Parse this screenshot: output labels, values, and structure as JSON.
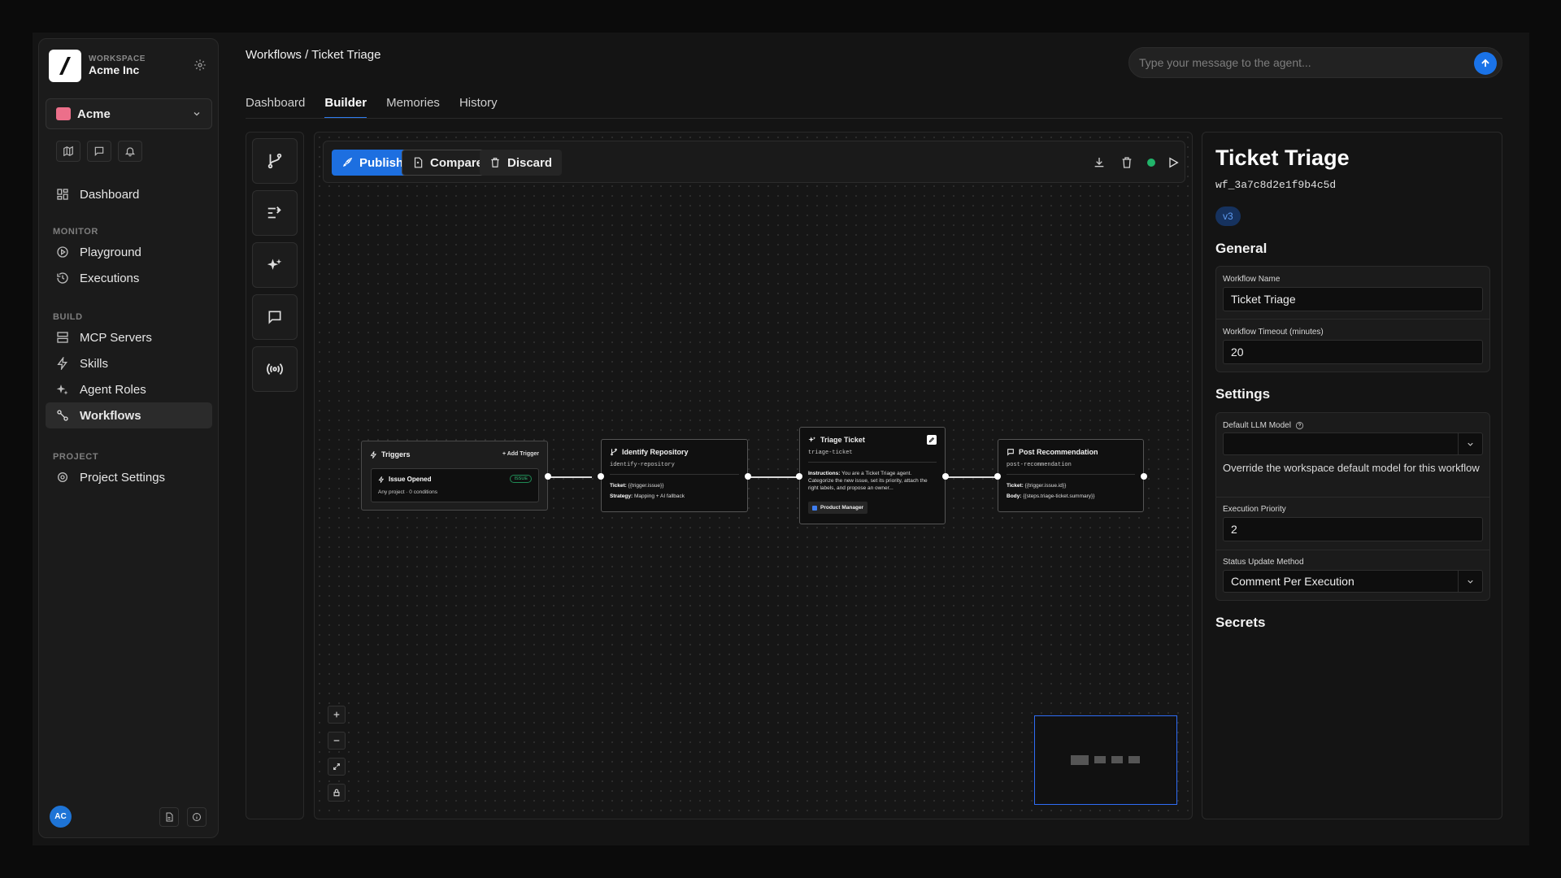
{
  "workspace": {
    "label": "WORKSPACE",
    "name": "Acme Inc"
  },
  "org": {
    "name": "Acme",
    "color": "#ec6f8a"
  },
  "sidebar": {
    "dashboard": "Dashboard",
    "sections": {
      "monitor": "MONITOR",
      "build": "BUILD",
      "project": "PROJECT"
    },
    "items": {
      "playground": "Playground",
      "executions": "Executions",
      "mcp_servers": "MCP Servers",
      "skills": "Skills",
      "agent_roles": "Agent Roles",
      "workflows": "Workflows",
      "project_settings": "Project Settings"
    },
    "avatar": "AC"
  },
  "header": {
    "breadcrumb": "Workflows / Ticket Triage",
    "agent_placeholder": "Type your message to the agent...",
    "tabs": [
      "Dashboard",
      "Builder",
      "Memories",
      "History"
    ],
    "active_tab": "Builder"
  },
  "toolbar": {
    "publish": "Publish",
    "compare": "Compare",
    "discard": "Discard",
    "status_color": "#21b46a"
  },
  "nodes": {
    "triggers": {
      "title": "Triggers",
      "add": "+ Add Trigger",
      "item_title": "Issue Opened",
      "item_badge": "ISSUE",
      "item_sub": "Any project · 0 conditions"
    },
    "identify": {
      "title": "Identify Repository",
      "slug": "identify-repository",
      "ticket_label": "Ticket:",
      "ticket_value": "{{trigger.issue}}",
      "strategy_label": "Strategy:",
      "strategy_value": "Mapping + AI fallback"
    },
    "triage": {
      "title": "Triage Ticket",
      "slug": "triage-ticket",
      "instr_label": "Instructions:",
      "instr_value": "You are a Ticket Triage agent. Categorize the new issue, set its priority, attach the right labels, and propose an owner...",
      "role": "Product Manager"
    },
    "post": {
      "title": "Post Recommendation",
      "slug": "post-recommendation",
      "ticket_label": "Ticket:",
      "ticket_value": "{{trigger.issue.id}}",
      "body_label": "Body:",
      "body_value": "{{steps.triage-ticket.summary}}"
    }
  },
  "panel": {
    "title": "Ticket Triage",
    "id": "wf_3a7c8d2e1f9b4c5d",
    "version": "v3",
    "general_heading": "General",
    "workflow_name_label": "Workflow Name",
    "workflow_name_value": "Ticket Triage",
    "timeout_label": "Workflow Timeout (minutes)",
    "timeout_value": "20",
    "settings_heading": "Settings",
    "llm_label": "Default LLM Model",
    "llm_value": "",
    "llm_help": "Override the workspace default model for this workflow",
    "priority_label": "Execution Priority",
    "priority_value": "2",
    "status_label": "Status Update Method",
    "status_value": "Comment Per Execution",
    "secrets_heading": "Secrets"
  }
}
